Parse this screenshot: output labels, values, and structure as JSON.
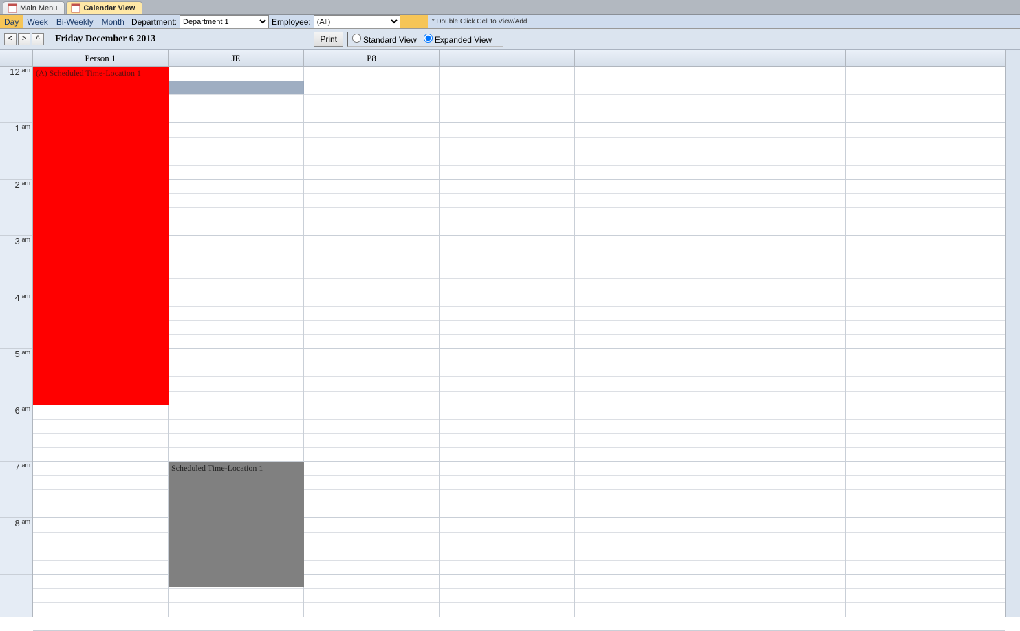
{
  "tabs": {
    "main": "Main Menu",
    "calendar": "Calendar View"
  },
  "viewModes": {
    "day": "Day",
    "week": "Week",
    "biweekly": "Bi-Weekly",
    "month": "Month"
  },
  "filters": {
    "deptLabel": "Department:",
    "deptValue": "Department 1",
    "empLabel": "Employee:",
    "empValue": "(All)",
    "hint": "* Double Click Cell to View/Add"
  },
  "nav": {
    "prev": "<",
    "next": ">",
    "up": "^",
    "date": "Friday December 6 2013",
    "print": "Print",
    "stdView": "Standard View",
    "expView": "Expanded View"
  },
  "columns": [
    "Person 1",
    "JE",
    "P8",
    "",
    "",
    "",
    ""
  ],
  "timeLabels": [
    {
      "hr": "12",
      "ampm": "am"
    },
    {
      "hr": "1",
      "ampm": "am"
    },
    {
      "hr": "2",
      "ampm": "am"
    },
    {
      "hr": "3",
      "ampm": "am"
    },
    {
      "hr": "4",
      "ampm": "am"
    },
    {
      "hr": "5",
      "ampm": "am"
    },
    {
      "hr": "6",
      "ampm": "am"
    },
    {
      "hr": "7",
      "ampm": "am"
    },
    {
      "hr": "8",
      "ampm": "am"
    }
  ],
  "events": {
    "e1": "(A) Scheduled Time-Location 1",
    "e2": "Scheduled Time-Location 1"
  }
}
